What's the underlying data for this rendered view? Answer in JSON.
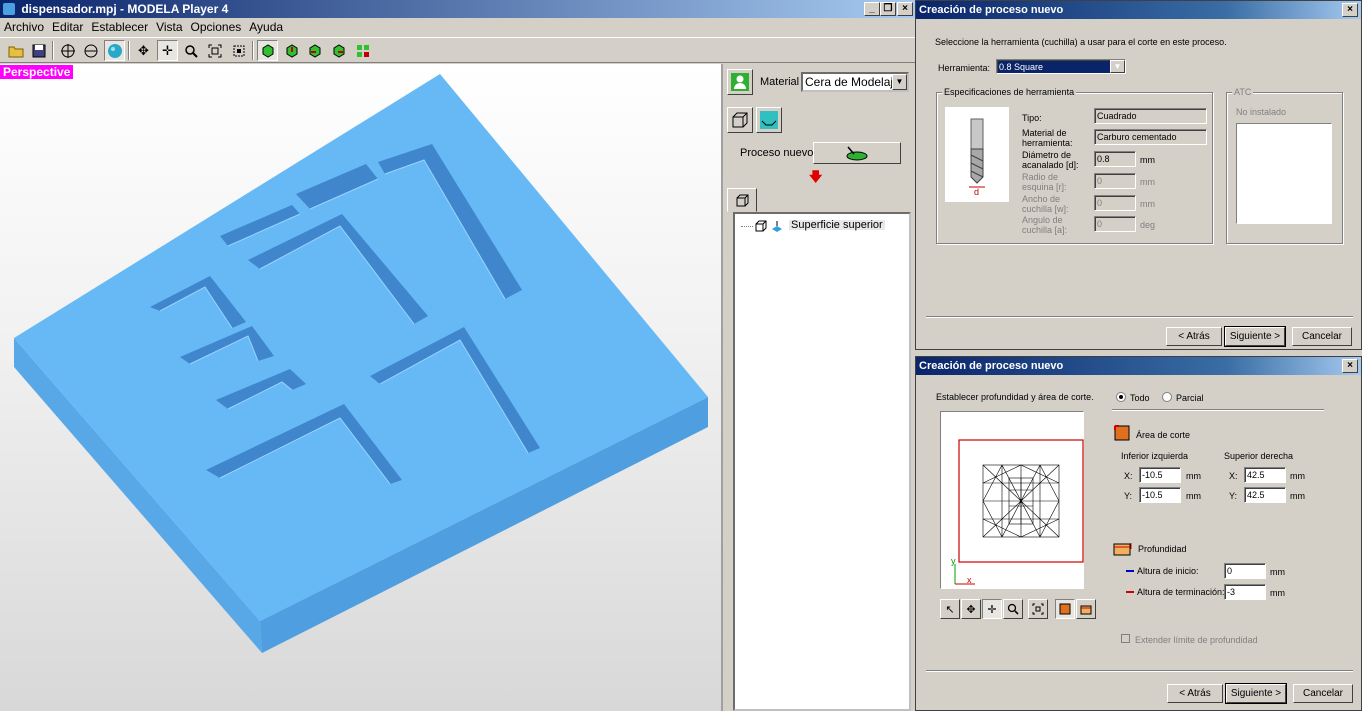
{
  "main": {
    "title": "dispensador.mpj - MODELA Player 4",
    "window_buttons": [
      "_",
      "̱×",
      "×"
    ],
    "menu": [
      "Archivo",
      "Editar",
      "Establecer",
      "Vista",
      "Opciones",
      "Ayuda"
    ],
    "viewport_label": "Perspective",
    "material_label": "Material",
    "material_value": "Cera de Modelaje",
    "new_process_label": "Proceso nuevo",
    "tree_item": "Superficie superior"
  },
  "dialog1": {
    "title": "Creación de proceso nuevo",
    "instruction": "Seleccione la herramienta (cuchilla) a usar para el corte en este proceso.",
    "tool_label": "Herramienta:",
    "tool_value": "0.8 Square",
    "specs_group": "Especificaciones de herramienta",
    "tipo_label": "Tipo:",
    "tipo_value": "Cuadrado",
    "material_label_1": "Material de",
    "material_label_2": "herramienta:",
    "material_value": "Carburo cementado",
    "diametro_label_1": "Diámetro de",
    "diametro_label_2": "acanalado [d]:",
    "diametro_value": "0.8",
    "diametro_unit": "mm",
    "radio_label_1": "Radio de",
    "radio_label_2": "esquina [r]:",
    "radio_value": "0",
    "radio_unit": "mm",
    "ancho_label_1": "Ancho de",
    "ancho_label_2": "cuchilla [w]:",
    "ancho_value": "0",
    "ancho_unit": "mm",
    "angulo_label_1": "Angulo de",
    "angulo_label_2": "cuchilla [a]:",
    "angulo_value": "0",
    "angulo_unit": "deg",
    "tool_image_label": "d",
    "atc_group": "ATC",
    "atc_status": "No instalado",
    "back": "< Atrás",
    "next": "Siguiente >",
    "cancel": "Cancelar"
  },
  "dialog2": {
    "title": "Creación de proceso nuevo",
    "instruction": "Establecer profundidad y área de corte.",
    "radio_todo": "Todo",
    "radio_parcial": "Parcial",
    "area_label": "Área de corte",
    "lower_left": "Inferior izquierda",
    "upper_right": "Superior derecha",
    "x_label": "X:",
    "y_label": "Y:",
    "ll_x": "-10.5",
    "ll_y": "-10.5",
    "ur_x": "42.5",
    "ur_y": "42.5",
    "unit": "mm",
    "axis_y": "y",
    "axis_x": "x",
    "depth_label": "Profundidad",
    "start_label": "Altura de inicio:",
    "start_value": "0",
    "end_label": "Altura de terminación:",
    "end_value": "-3",
    "extend_label": "Extender límite de profundidad",
    "back": "< Atrás",
    "next": "Siguiente >",
    "cancel": "Cancelar"
  },
  "colors": {
    "model_top": "#64b8f4",
    "model_side": "#5aa6e6",
    "groove": "#4a92d6",
    "title_bar": "#0a246a",
    "area_frame": "#cc0000"
  }
}
